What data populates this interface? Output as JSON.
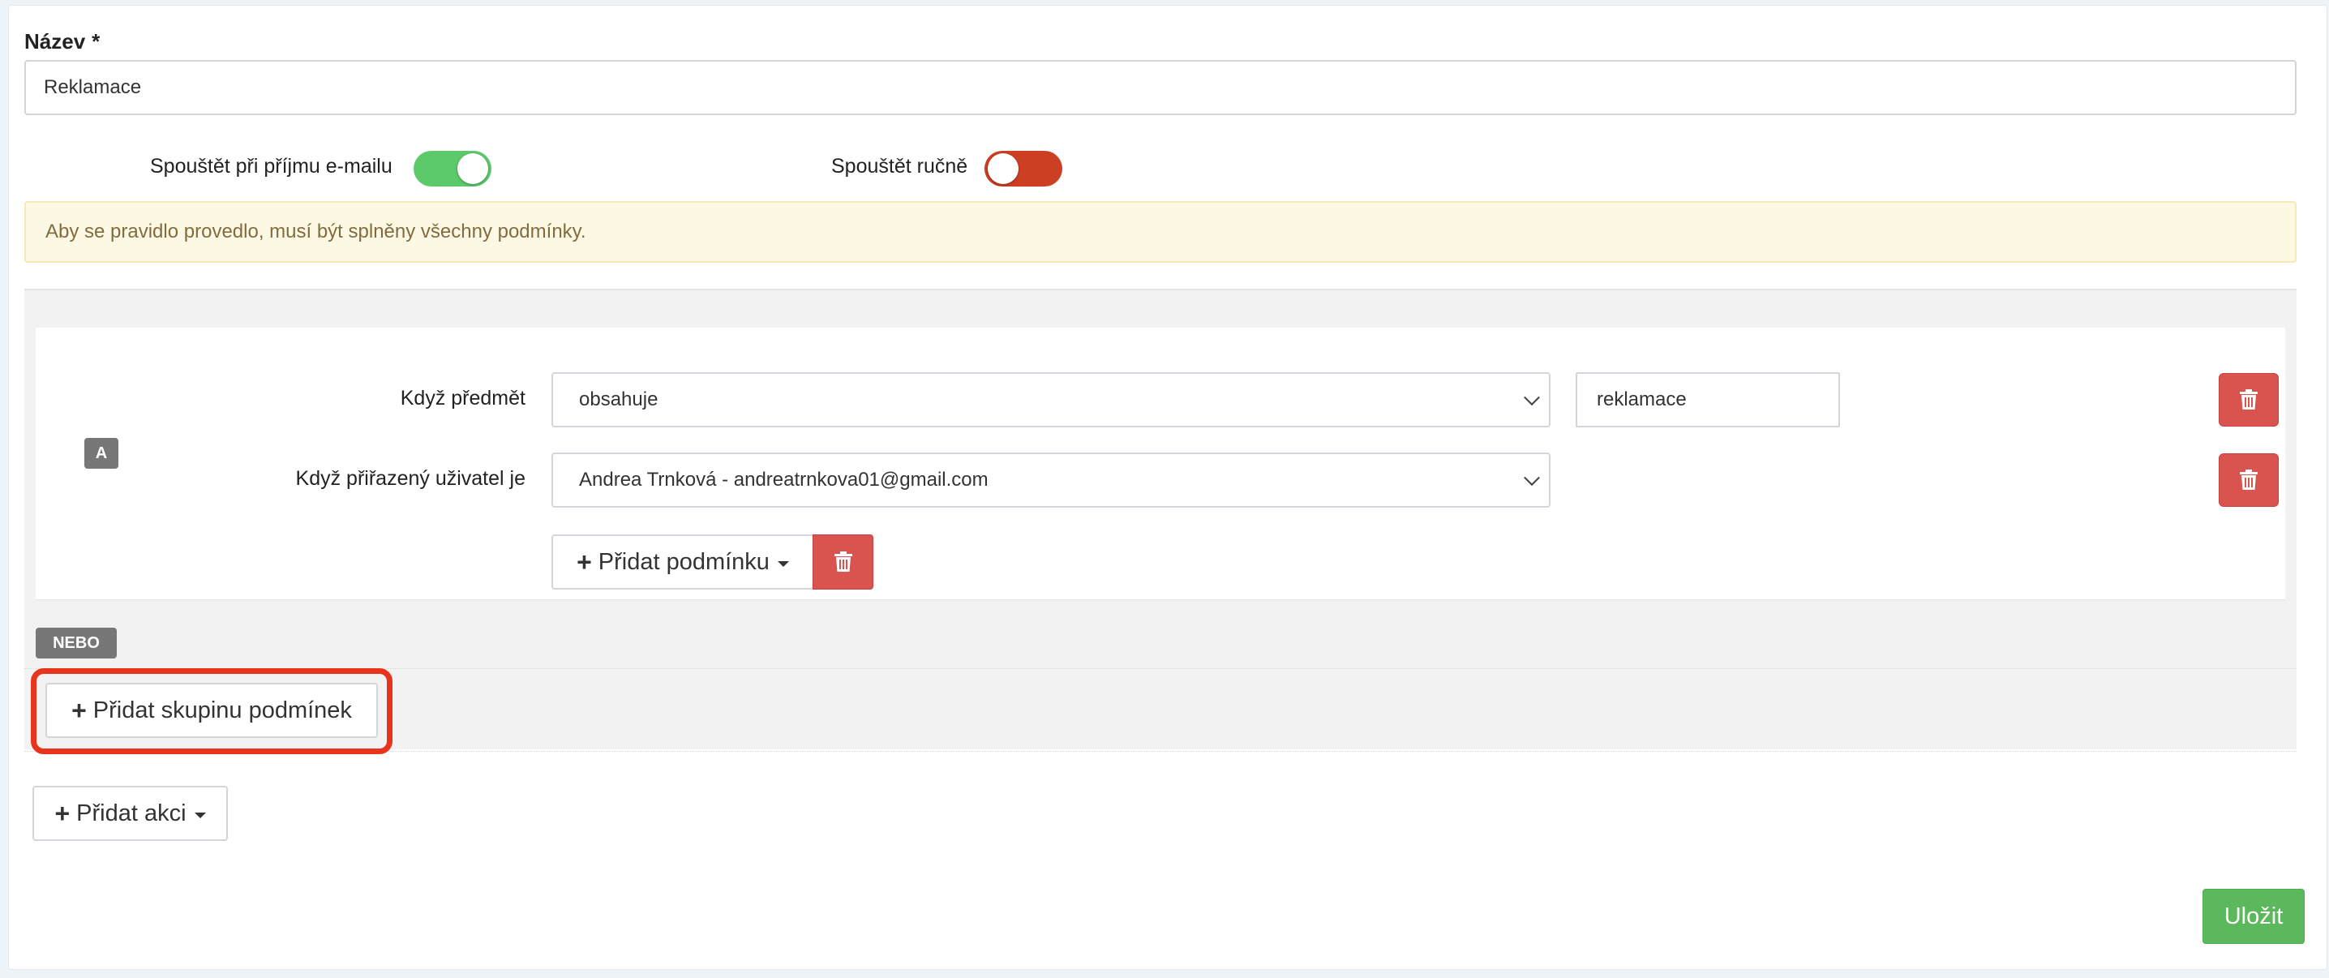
{
  "form": {
    "name_label": "Název",
    "required_mark": "*",
    "name_value": "Reklamace"
  },
  "toggles": {
    "on_email": {
      "label": "Spouštět při příjmu e-mailu",
      "state": "on",
      "color": "#5cca6b"
    },
    "manual": {
      "label": "Spouštět ručně",
      "state": "off",
      "color": "#cc3f22"
    }
  },
  "alert": {
    "text": "Aby se pravidlo provedlo, musí být splněny všechny podmínky."
  },
  "group": {
    "badge": "A",
    "conditions": [
      {
        "label": "Když předmět",
        "operator": "obsahuje",
        "value": "reklamace"
      },
      {
        "label": "Když přiřazený uživatel je",
        "operator": "Andrea Trnková - andreatrnkova01@gmail.com"
      }
    ],
    "add_condition_label": "Přidat podmínku"
  },
  "or_badge": "NEBO",
  "add_group_label": "Přidat skupinu podmínek",
  "add_action_label": "Přidat akci",
  "save_label": "Uložit",
  "icons": {
    "plus": "plus-icon",
    "caret": "caret-down-icon",
    "trash": "trash-icon",
    "chevron": "chevron-down-icon"
  },
  "colors": {
    "danger": "#d9534f",
    "success": "#5cb85c",
    "highlight": "#e8341c",
    "alert_bg": "#fcf8e3"
  }
}
